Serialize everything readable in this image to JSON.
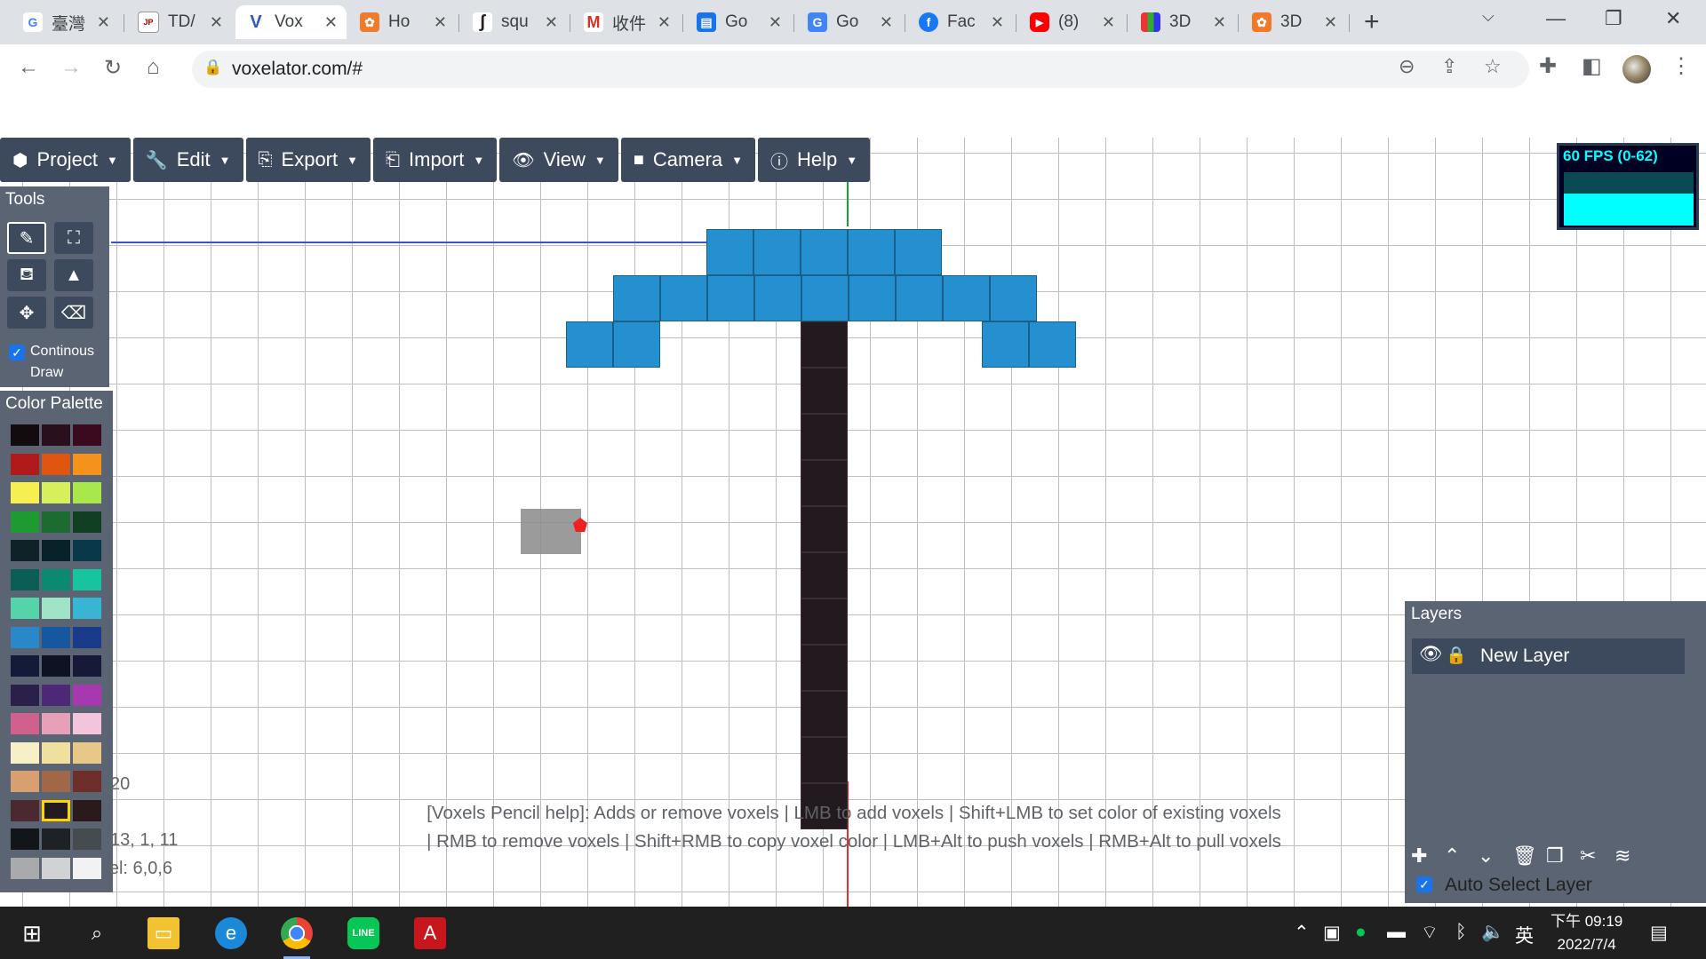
{
  "browser": {
    "tabs": [
      {
        "label": "臺灣",
        "icon": "google-icon"
      },
      {
        "label": "TD/",
        "icon": "td-icon"
      },
      {
        "label": "Vox",
        "icon": "voxelator-icon",
        "active": true
      },
      {
        "label": "Ho",
        "icon": "pinwheel-icon"
      },
      {
        "label": "squ",
        "icon": "script-icon"
      },
      {
        "label": "收件",
        "icon": "gmail-icon"
      },
      {
        "label": "Go",
        "icon": "google-sheets-icon"
      },
      {
        "label": "Go",
        "icon": "google-translate-icon"
      },
      {
        "label": "Fac",
        "icon": "facebook-icon"
      },
      {
        "label": "(8)",
        "icon": "youtube-icon"
      },
      {
        "label": "3D",
        "icon": "grid-icon"
      },
      {
        "label": "3D",
        "icon": "pinwheel-icon"
      }
    ],
    "url": "voxelator.com/#"
  },
  "menu": [
    {
      "label": "Project",
      "icon": "cube-icon"
    },
    {
      "label": "Edit",
      "icon": "wrench-icon"
    },
    {
      "label": "Export",
      "icon": "file-export-icon"
    },
    {
      "label": "Import",
      "icon": "file-import-icon"
    },
    {
      "label": "View",
      "icon": "eye-icon"
    },
    {
      "label": "Camera",
      "icon": "video-icon"
    },
    {
      "label": "Help",
      "icon": "info-icon"
    }
  ],
  "tools": {
    "title": "Tools",
    "buttons": [
      "pencil-icon",
      "expand-icon",
      "fill-bucket-icon",
      "shapes-icon",
      "move-icon",
      "eraser-icon"
    ],
    "continuous_draw": "Continous Draw",
    "continuous_checked": true
  },
  "palette": {
    "title": "Color Palette",
    "rows": [
      [
        "#120c0e",
        "#2a0f1c",
        "#3b0a1f"
      ],
      [
        "#b01a1a",
        "#e05510",
        "#f5921b"
      ],
      [
        "#f6ef50",
        "#d6ef5a",
        "#a8e84a"
      ],
      [
        "#1e9a32",
        "#1c6b30",
        "#103f24"
      ],
      [
        "#0f2228",
        "#08222a",
        "#08384a"
      ],
      [
        "#0a5e56",
        "#0a8a70",
        "#16c4a0"
      ],
      [
        "#54d4a8",
        "#a0e4c8",
        "#3ab4d4"
      ],
      [
        "#2a88c8",
        "#1658a0",
        "#1a3a8a"
      ],
      [
        "#141a38",
        "#0e1222",
        "#161a38"
      ],
      [
        "#2a204a",
        "#4e2878",
        "#a838b0"
      ],
      [
        "#d0608c",
        "#e8a0b8",
        "#f4c4dc"
      ],
      [
        "#f6f0c8",
        "#f0e0a0",
        "#e8c888"
      ],
      [
        "#d8a070",
        "#a06848",
        "#6e2e2a"
      ],
      [
        "#4a2a30",
        "#231a1f",
        "#2a1a1c"
      ],
      [
        "#121618",
        "#1e2224",
        "#444c50"
      ],
      [
        "#a8aaac",
        "#d0d2d4",
        "#f2f2f2"
      ]
    ],
    "selected": [
      13,
      1
    ]
  },
  "overlay_text": {
    "line_a": "20",
    "line_b": "13, 1, 11",
    "line_c": "el: 6,0,6"
  },
  "fps": {
    "label": "60 FPS (0-62)",
    "level": 0.6
  },
  "help_text": "[Voxels Pencil help]: Adds or remove voxels | LMB to add voxels | Shift+LMB to set color of existing voxels | RMB to remove voxels | Shift+RMB to copy voxel color | LMB+Alt to push voxels | RMB+Alt to pull voxels",
  "layers": {
    "title": "Layers",
    "items": [
      {
        "name": "New Layer"
      }
    ],
    "auto_select": "Auto Select Layer",
    "auto_select_checked": true
  },
  "colors": {
    "voxel_blue": "#2590cf",
    "voxel_dark": "#231a1f",
    "ui_panel": "#3d4a5d"
  },
  "taskbar": {
    "time": "下午 09:19",
    "date": "2022/7/4",
    "ime": "英"
  }
}
